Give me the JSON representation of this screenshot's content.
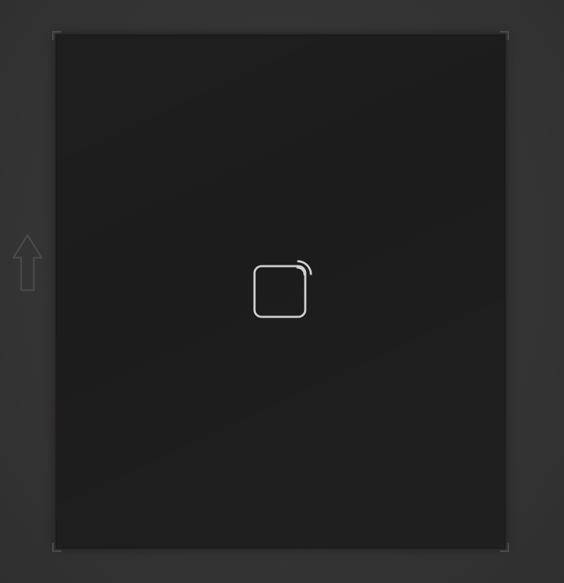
{
  "screen": {
    "background_color": "#353535",
    "frame_color": "#1c1c1c",
    "icon_color": "#d0d0d0"
  },
  "icons": {
    "center": "square-with-signal-icon",
    "side": "up-arrow-icon",
    "corners": "crop-corner-handle-icon"
  }
}
